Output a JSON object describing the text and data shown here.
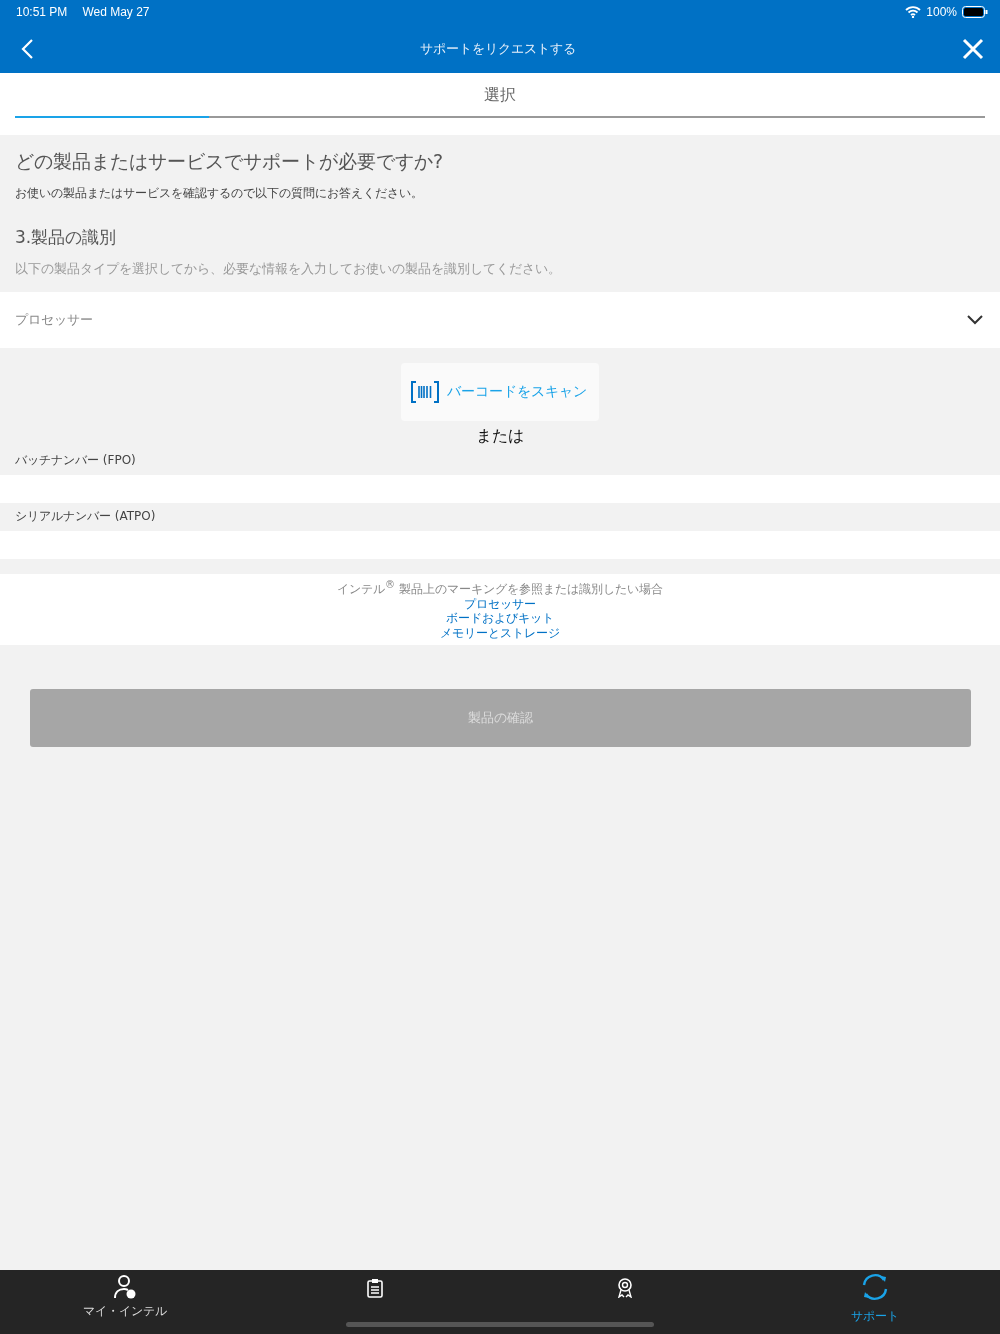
{
  "status_bar": {
    "time": "10:51 PM",
    "date": "Wed May 27",
    "battery": "100%"
  },
  "nav": {
    "title": "サポートをリクエストする"
  },
  "step": {
    "label": "選択",
    "level": 0.2
  },
  "heading": "どの製品またはサービスでサポートが必要ですか?",
  "subheading": "お使いの製品またはサービスを確認するので以下の質問にお答えください。",
  "section": {
    "title": "3.製品の識別",
    "description": "以下の製品タイプを選択してから、必要な情報を入力してお使いの製品を識別してください。"
  },
  "product_type": {
    "value": "プロセッサー"
  },
  "scan_button": "バーコードをスキャン",
  "or_text": "または",
  "fields": [
    {
      "label": "バッチナンバー (FPO)"
    },
    {
      "label": "シリアルナンバー (ATPO)"
    }
  ],
  "info": {
    "text": "インテル$^{®}$ 製品上のマーキングを参照または識別したい場合",
    "links": [
      "プロセッサー",
      "ボードおよびキット",
      "メモリーとストレージ"
    ]
  },
  "confirm_button": {
    "label": "製品の確認",
    "disabled": true
  },
  "tab_bar": [
    {
      "kind": "person",
      "label": "マイ・インテル",
      "selected": false
    },
    {
      "kind": "clipboard",
      "selected": false
    },
    {
      "kind": "award",
      "selected": false
    },
    {
      "kind": "sync",
      "label": "サポート",
      "selected": true
    }
  ]
}
